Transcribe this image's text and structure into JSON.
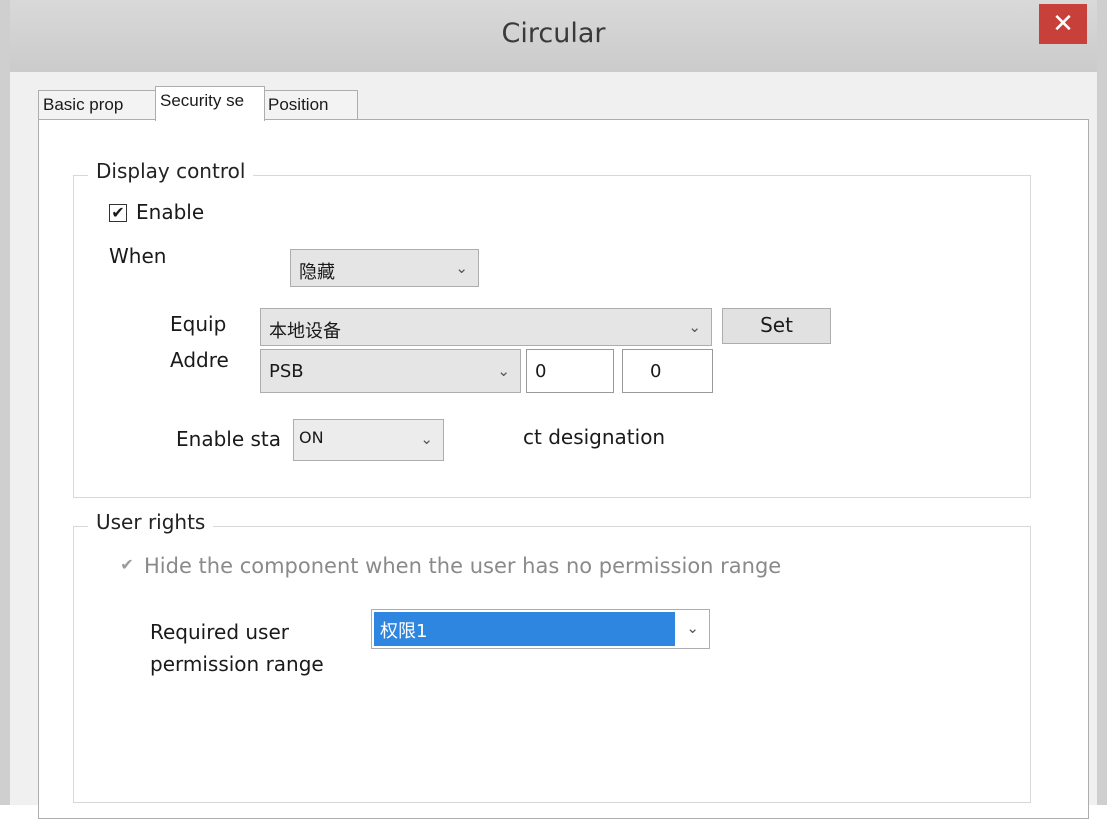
{
  "window": {
    "title": "Circular",
    "close_glyph": "✕"
  },
  "tabs": [
    {
      "label": "Basic prop"
    },
    {
      "label": "Security se"
    },
    {
      "label": "Position"
    }
  ],
  "display_control": {
    "legend": "Display control",
    "enable_label": "Enable",
    "enable_checked": true,
    "when_label": "When",
    "when_value": "隐藏",
    "equip_label": "Equip",
    "equip_value": "本地设备",
    "set_button": "Set",
    "addr_label": "Addre",
    "addr_type": "PSB",
    "addr_value1": "0",
    "addr_value2": "0",
    "enable_state_label": "Enable sta",
    "enable_state_value": "ON",
    "bit_note": "ct designation"
  },
  "user_rights": {
    "legend": "User rights",
    "hide_label": "Hide the component when the user has no permission range",
    "hide_checked": true,
    "required_label_line1": "Required user",
    "required_label_line2": "permission range",
    "permission_value": "权限1"
  },
  "icons": {
    "chevron": "chevron-down-icon",
    "check": "checkmark-icon"
  },
  "colors": {
    "selection": "#2f86e1",
    "close": "#c7403a"
  }
}
